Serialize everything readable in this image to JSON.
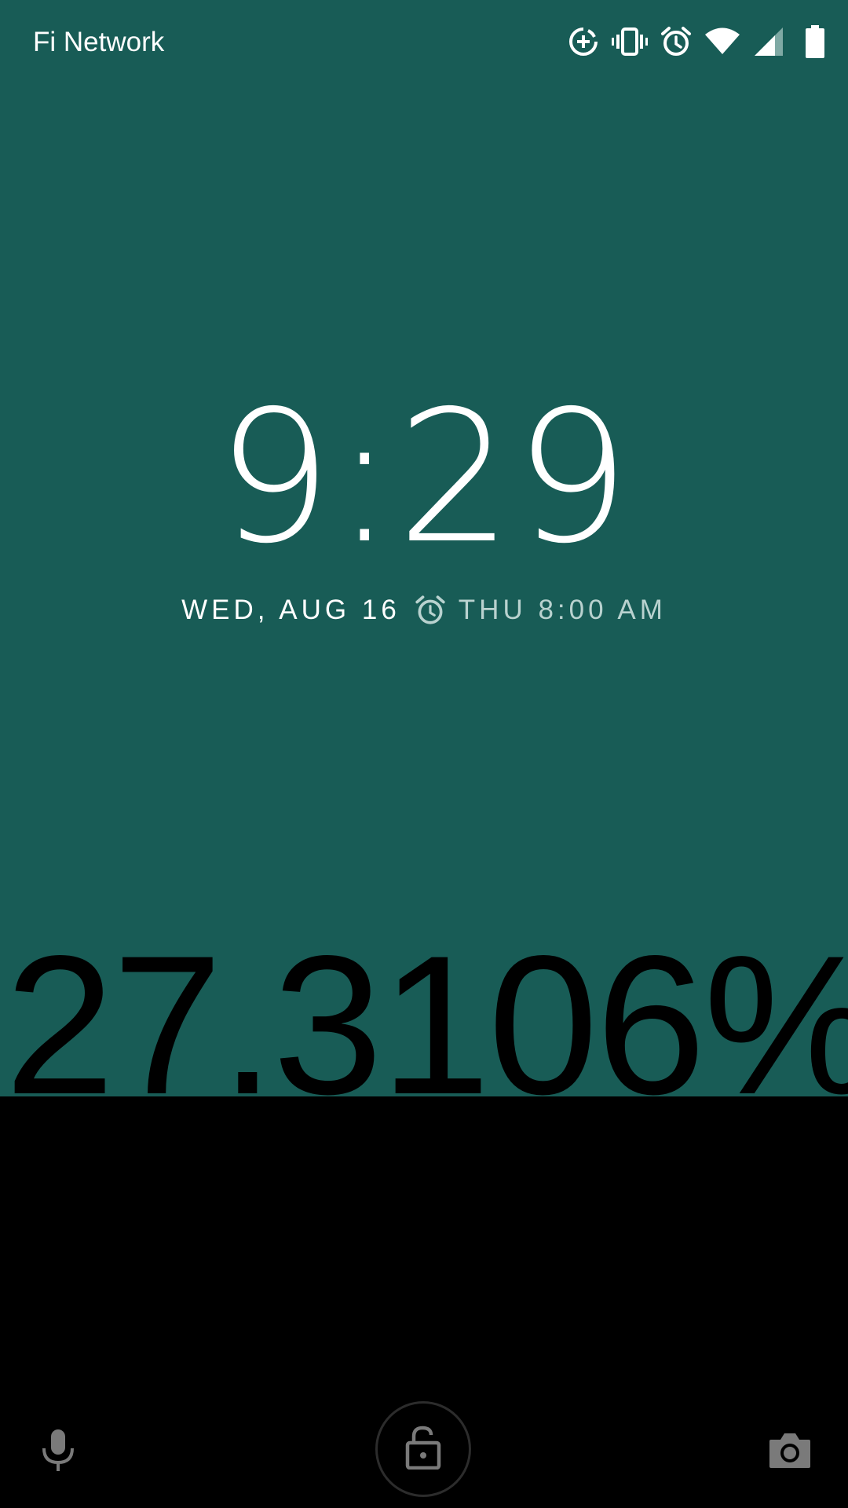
{
  "status_bar": {
    "carrier": "Fi Network",
    "icons": [
      "data-saver-icon",
      "vibrate-icon",
      "alarm-icon",
      "wifi-icon",
      "cell-signal-icon",
      "battery-icon"
    ]
  },
  "lockscreen": {
    "time": "9:29",
    "date": "WED, AUG 16",
    "next_alarm": "THU 8:00 AM",
    "overlay_percent": "27.3106%"
  },
  "bottom_bar": {
    "left_icon": "microphone-icon",
    "center_icon": "unlock-icon",
    "right_icon": "camera-icon"
  },
  "colors": {
    "wallpaper": "#185c56",
    "bottom": "#000000",
    "text_primary": "#ffffff",
    "text_secondary": "#b9d2cf",
    "icon_dim": "#7a7a7a"
  }
}
